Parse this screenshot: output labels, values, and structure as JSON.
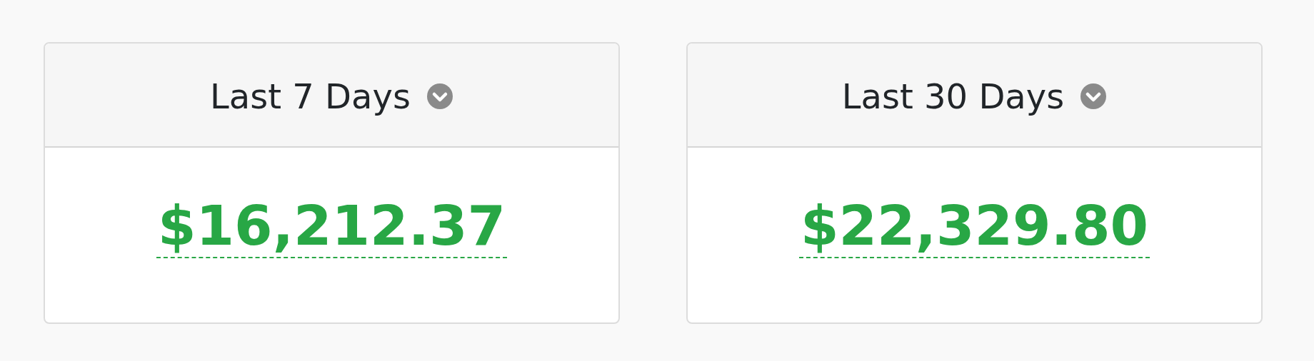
{
  "cards": [
    {
      "title": "Last 7 Days",
      "amount": "$16,212.37"
    },
    {
      "title": "Last 30 Days",
      "amount": "$22,329.80"
    }
  ]
}
